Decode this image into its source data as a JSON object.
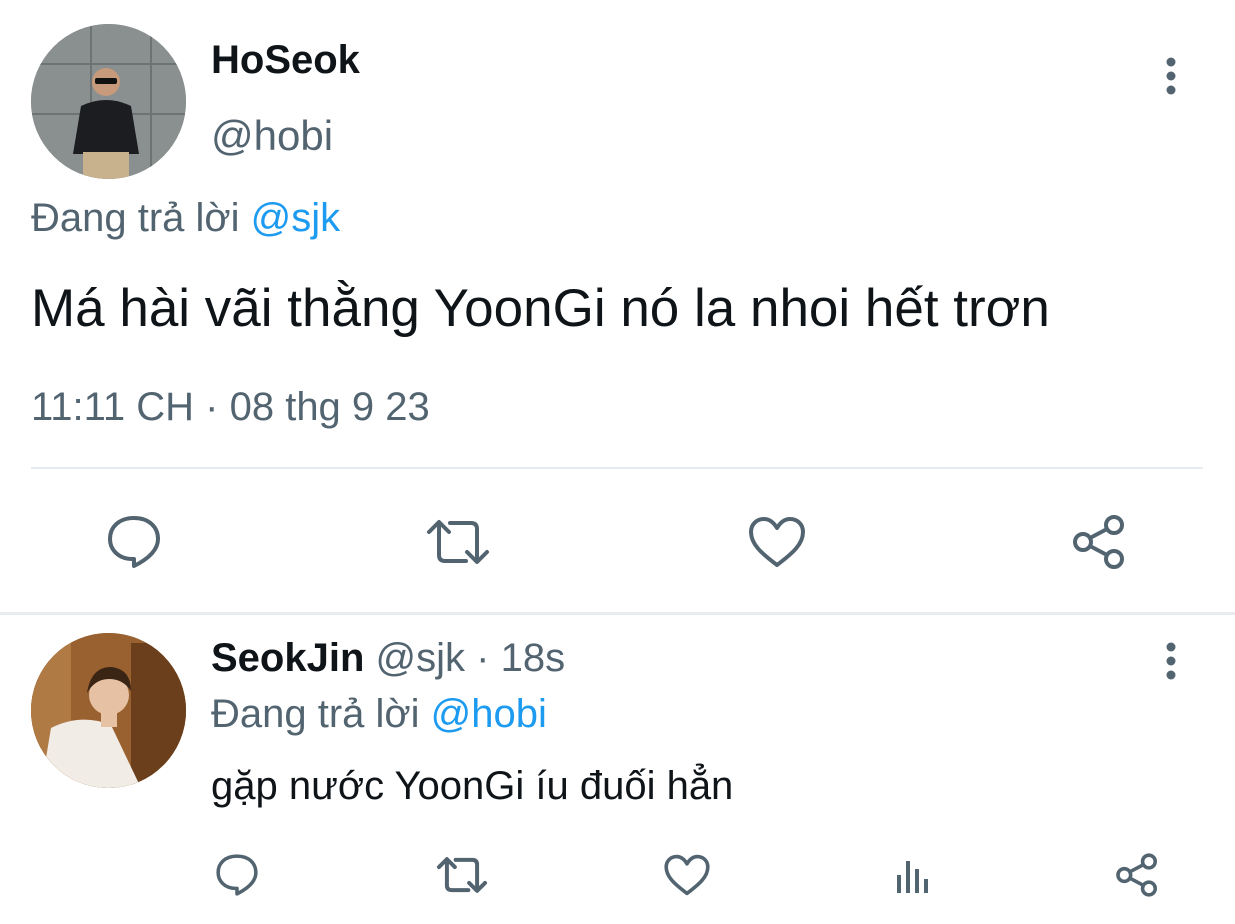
{
  "main_tweet": {
    "display_name": "HoSeok",
    "handle": "@hobi",
    "reply_prefix": "Đang trả lời",
    "reply_to": "@sjk",
    "text": "Má hài vãi thằng YoonGi nó la nhoi hết trơn",
    "timestamp": "11:11 CH · 08 thg 9 23",
    "avatar_icon": "person-photo-avatar",
    "actions": [
      "comment-icon",
      "retweet-icon",
      "heart-icon",
      "share-icon"
    ]
  },
  "reply_tweet": {
    "display_name": "SeokJin",
    "handle": "@sjk",
    "separator": "·",
    "time_ago": "18s",
    "reply_prefix": "Đang trả lời",
    "reply_to": "@hobi",
    "text": "gặp nước YoonGi íu đuối hẳn",
    "avatar_icon": "person-photo-avatar",
    "actions": [
      "comment-icon",
      "retweet-icon",
      "heart-icon",
      "analytics-icon",
      "share-icon"
    ]
  },
  "colors": {
    "text": "#0f1419",
    "muted": "#536471",
    "link": "#1d9bf0",
    "divider": "#e6ecf0"
  }
}
